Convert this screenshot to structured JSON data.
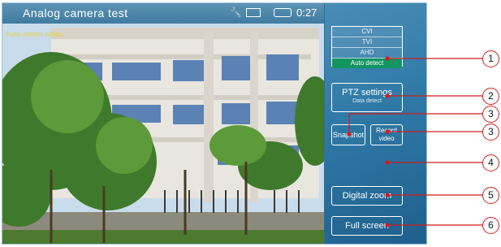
{
  "header": {
    "title": "Analog camera test",
    "time": "0:27"
  },
  "video": {
    "overlay": "Auto detect video"
  },
  "modes": [
    "CVI",
    "TVI",
    "AHD",
    "Auto detect"
  ],
  "ptz": {
    "label": "PTZ settings",
    "sub": "Data detect"
  },
  "buttons": {
    "snapshot": "Snapshot",
    "record": [
      "Record",
      "video"
    ],
    "digital_zoom": "Digital zoom",
    "full_screen": "Full screen"
  },
  "callouts": [
    "1",
    "2",
    "3",
    "3",
    "4",
    "5",
    "6"
  ],
  "colors": {
    "accent_green": "#12955f",
    "callout_red": "#cc1f1f"
  }
}
